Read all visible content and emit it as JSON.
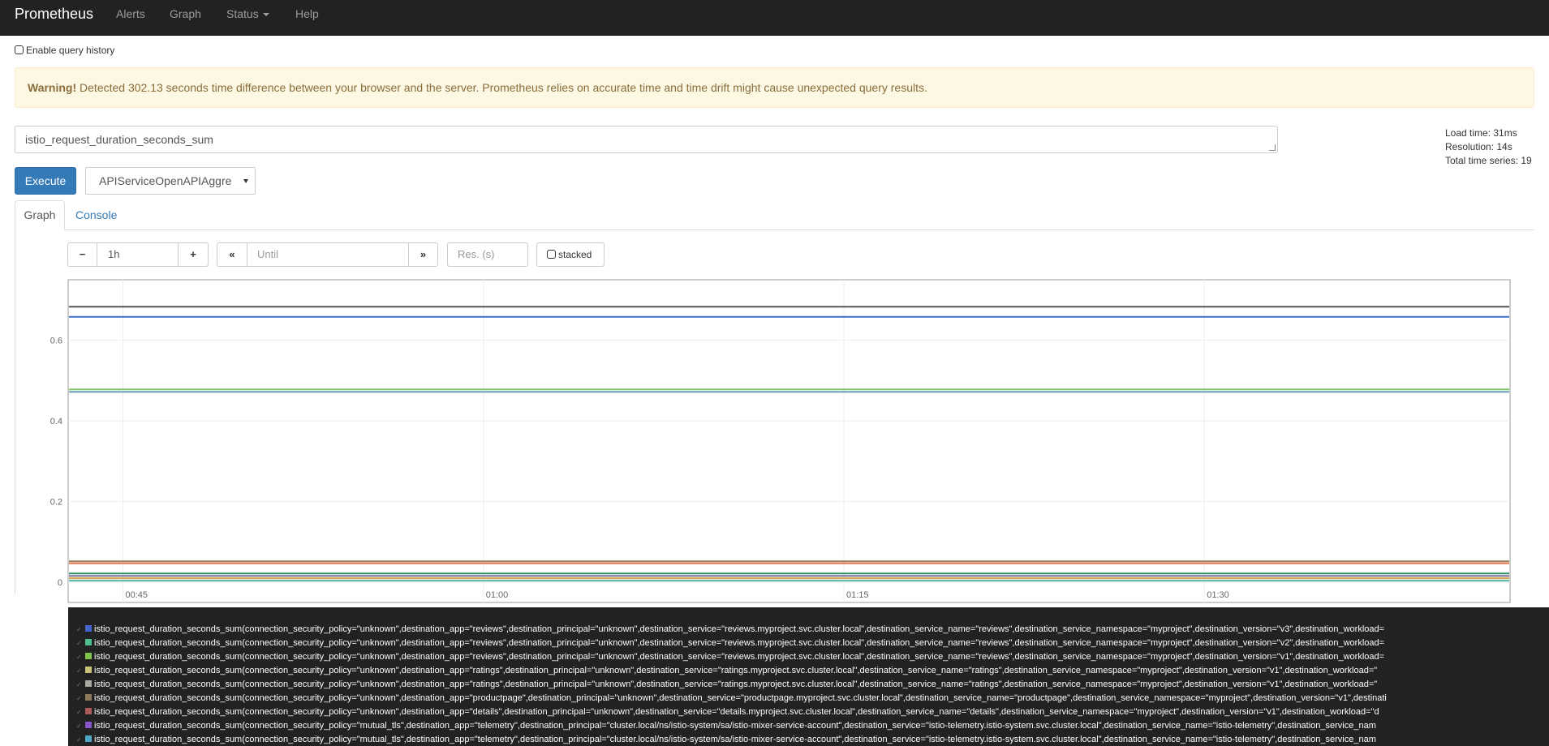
{
  "nav": {
    "brand": "Prometheus",
    "items": [
      "Alerts",
      "Graph",
      "Status",
      "Help"
    ]
  },
  "history_label": "Enable query history",
  "warning": {
    "strong": "Warning!",
    "text": "Detected 302.13 seconds time difference between your browser and the server. Prometheus relies on accurate time and time drift might cause unexpected query results."
  },
  "expression": "istio_request_duration_seconds_sum",
  "stats": {
    "load_time": "Load time: 31ms",
    "resolution": "Resolution: 14s",
    "total_series": "Total time series: 19"
  },
  "execute_label": "Execute",
  "metric_select": "APIServiceOpenAPIAggre",
  "tabs": {
    "graph": "Graph",
    "console": "Console"
  },
  "controls": {
    "minus": "−",
    "range": "1h",
    "plus": "+",
    "back": "«",
    "until_placeholder": "Until",
    "forward": "»",
    "res_placeholder": "Res. (s)",
    "stacked": "stacked"
  },
  "chart_data": {
    "type": "line",
    "ylim": [
      -0.05,
      0.75
    ],
    "y_ticks": [
      0,
      0.2,
      0.4,
      0.6
    ],
    "y_tick_labels": [
      "0",
      "0.2",
      "0.4",
      "0.6"
    ],
    "x_tick_labels": [
      "00:45",
      "01:00",
      "01:15",
      "01:30"
    ],
    "grid": true,
    "series": [
      {
        "color": "#555555",
        "values": [
          0.683,
          0.683
        ]
      },
      {
        "color": "#3f6fc2",
        "values": [
          0.658,
          0.658
        ]
      },
      {
        "color": "#7fc36a",
        "values": [
          0.478,
          0.478
        ]
      },
      {
        "color": "#6aa0b5",
        "values": [
          0.472,
          0.472
        ]
      },
      {
        "color": "#9a7b5a",
        "values": [
          0.052,
          0.052
        ]
      },
      {
        "color": "#e07b52",
        "values": [
          0.047,
          0.047
        ]
      },
      {
        "color": "#2f8f5f",
        "values": [
          0.022,
          0.022
        ]
      },
      {
        "color": "#7a6e9e",
        "values": [
          0.016,
          0.016
        ]
      },
      {
        "color": "#d3a440",
        "values": [
          0.01,
          0.01
        ]
      },
      {
        "color": "#4fb7a8",
        "values": [
          0.004,
          0.004
        ]
      }
    ]
  },
  "legend": [
    {
      "color": "#4466cc",
      "text": "istio_request_duration_seconds_sum(connection_security_policy=\"unknown\",destination_app=\"reviews\",destination_principal=\"unknown\",destination_service=\"reviews.myproject.svc.cluster.local\",destination_service_name=\"reviews\",destination_service_namespace=\"myproject\",destination_version=\"v3\",destination_workload="
    },
    {
      "color": "#4fbf8f",
      "text": "istio_request_duration_seconds_sum(connection_security_policy=\"unknown\",destination_app=\"reviews\",destination_principal=\"unknown\",destination_service=\"reviews.myproject.svc.cluster.local\",destination_service_name=\"reviews\",destination_service_namespace=\"myproject\",destination_version=\"v2\",destination_workload="
    },
    {
      "color": "#7fc34a",
      "text": "istio_request_duration_seconds_sum(connection_security_policy=\"unknown\",destination_app=\"reviews\",destination_principal=\"unknown\",destination_service=\"reviews.myproject.svc.cluster.local\",destination_service_name=\"reviews\",destination_service_namespace=\"myproject\",destination_version=\"v1\",destination_workload="
    },
    {
      "color": "#c9c07a",
      "text": "istio_request_duration_seconds_sum(connection_security_policy=\"unknown\",destination_app=\"ratings\",destination_principal=\"unknown\",destination_service=\"ratings.myproject.svc.cluster.local\",destination_service_name=\"ratings\",destination_service_namespace=\"myproject\",destination_version=\"v1\",destination_workload=\""
    },
    {
      "color": "#a9a9a0",
      "text": "istio_request_duration_seconds_sum(connection_security_policy=\"unknown\",destination_app=\"ratings\",destination_principal=\"unknown\",destination_service=\"ratings.myproject.svc.cluster.local\",destination_service_name=\"ratings\",destination_service_namespace=\"myproject\",destination_version=\"v1\",destination_workload=\""
    },
    {
      "color": "#8a7a5a",
      "text": "istio_request_duration_seconds_sum(connection_security_policy=\"unknown\",destination_app=\"productpage\",destination_principal=\"unknown\",destination_service=\"productpage.myproject.svc.cluster.local\",destination_service_name=\"productpage\",destination_service_namespace=\"myproject\",destination_version=\"v1\",destinati"
    },
    {
      "color": "#b05a5a",
      "text": "istio_request_duration_seconds_sum(connection_security_policy=\"unknown\",destination_app=\"details\",destination_principal=\"unknown\",destination_service=\"details.myproject.svc.cluster.local\",destination_service_name=\"details\",destination_service_namespace=\"myproject\",destination_version=\"v1\",destination_workload=\"d"
    },
    {
      "color": "#8855cc",
      "text": "istio_request_duration_seconds_sum(connection_security_policy=\"mutual_tls\",destination_app=\"telemetry\",destination_principal=\"cluster.local/ns/istio-system/sa/istio-mixer-service-account\",destination_service=\"istio-telemetry.istio-system.svc.cluster.local\",destination_service_name=\"istio-telemetry\",destination_service_nam"
    },
    {
      "color": "#4fa8c8",
      "text": "istio_request_duration_seconds_sum(connection_security_policy=\"mutual_tls\",destination_app=\"telemetry\",destination_principal=\"cluster.local/ns/istio-system/sa/istio-mixer-service-account\",destination_service=\"istio-telemetry.istio-system.svc.cluster.local\",destination_service_name=\"istio-telemetry\",destination_service_nam"
    }
  ]
}
